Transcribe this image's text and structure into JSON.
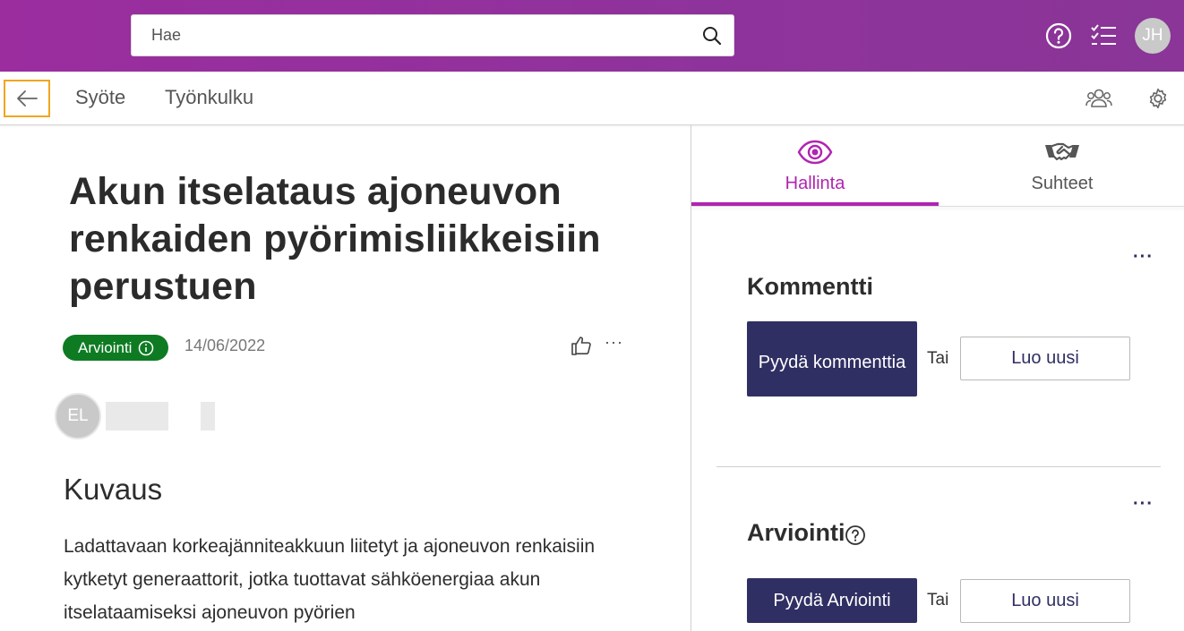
{
  "header": {
    "search_placeholder": "Hae",
    "user_initials": "JH",
    "icons": [
      "help-circle-icon",
      "checklist-icon",
      "search-icon"
    ]
  },
  "subnav": {
    "links": [
      "Syöte",
      "Työnkulku"
    ],
    "icons": [
      "back-arrow-icon",
      "people-icon",
      "gear-icon"
    ]
  },
  "main": {
    "title": "Akun itselataus ajoneuvon renkaiden pyörimisliikkeisiin perustuen",
    "status_badge": "Arviointi",
    "date": "14/06/2022",
    "author_initials": "EL",
    "section_heading": "Kuvaus",
    "description": "Ladattavaan korkeajänniteakkuun liitetyt ja ajoneuvon renkaisiin kytketyt generaattorit, jotka tuottavat sähköenergiaa akun itselataamiseksi ajoneuvon pyörien"
  },
  "panel": {
    "tabs": [
      {
        "label": "Hallinta",
        "icon": "eye-icon",
        "active": true
      },
      {
        "label": "Suhteet",
        "icon": "handshake-icon",
        "active": false
      }
    ],
    "comment": {
      "heading": "Kommentti",
      "request_label": "Pyydä kommenttia",
      "or_label": "Tai",
      "create_label": "Luo uusi"
    },
    "evaluation": {
      "heading": "Arviointi",
      "request_label": "Pyydä Arviointi",
      "or_label": "Tai",
      "create_label": "Luo uusi"
    }
  },
  "colors": {
    "header_bg": "#9b2d9f",
    "accent": "#b024b0",
    "primary_button": "#302f63",
    "badge_green": "#0e7b23",
    "focus_outline": "#f2a51f"
  }
}
